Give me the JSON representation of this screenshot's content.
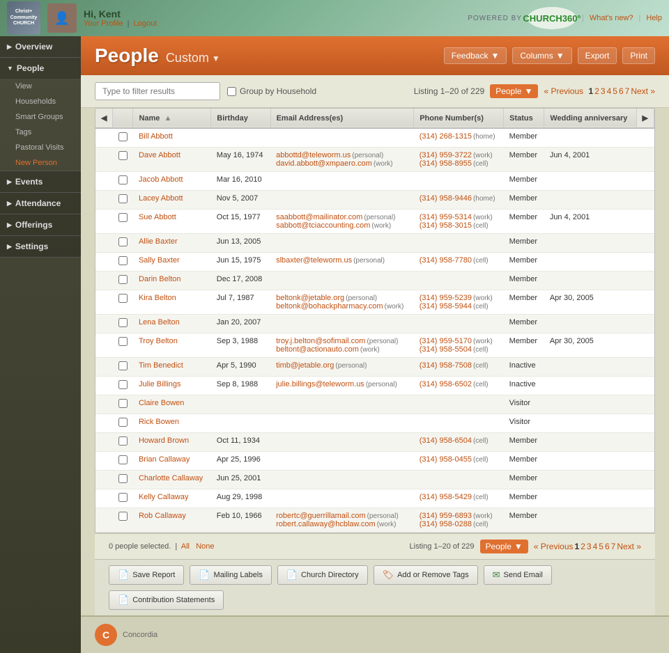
{
  "header": {
    "greeting": "Hi, Kent",
    "profile_link": "Your Profile",
    "logout_link": "Logout",
    "powered_by": "POWERED BY",
    "app_name": "CHURCH360°",
    "whats_new": "What's new?",
    "help": "Help"
  },
  "sidebar": {
    "overview_label": "Overview",
    "people_label": "People",
    "people_sub": {
      "view": "View",
      "households": "Households",
      "smart_groups": "Smart Groups",
      "tags": "Tags",
      "pastoral_visits": "Pastoral Visits",
      "new_person": "New Person"
    },
    "events_label": "Events",
    "attendance_label": "Attendance",
    "offerings_label": "Offerings",
    "settings_label": "Settings"
  },
  "page": {
    "title": "People",
    "subtitle": "Custom",
    "subtitle_arrow": "▼",
    "feedback_btn": "Feedback",
    "columns_btn": "Columns",
    "export_btn": "Export",
    "print_btn": "Print"
  },
  "filter": {
    "placeholder": "Type to filter results",
    "group_by_household": "Group by Household",
    "listing_prefix": "Listing",
    "listing_range": "1–20",
    "listing_of": "of",
    "listing_total": "229",
    "people_btn": "People",
    "prev": "« Previous",
    "pages": [
      "1",
      "2",
      "3",
      "4",
      "5",
      "6",
      "7"
    ],
    "next": "Next »"
  },
  "table": {
    "columns": [
      "Name",
      "Birthday",
      "Email Address(es)",
      "Phone Number(s)",
      "Status",
      "Wedding anniversary"
    ],
    "rows": [
      {
        "name": "Bill Abbott",
        "birthday": "",
        "emails": [],
        "phones": [
          {
            "val": "(314) 268-1315",
            "type": "home"
          }
        ],
        "status": "Member",
        "wedding": ""
      },
      {
        "name": "Dave Abbott",
        "birthday": "May 16, 1974",
        "emails": [
          {
            "val": "abbottd@teleworm.us",
            "type": "personal"
          },
          {
            "val": "david.abbott@xmpaero.com",
            "type": "work"
          }
        ],
        "phones": [
          {
            "val": "(314) 959-3722",
            "type": "work"
          },
          {
            "val": "(314) 958-8955",
            "type": "cell"
          }
        ],
        "status": "Member",
        "wedding": "Jun 4, 2001"
      },
      {
        "name": "Jacob Abbott",
        "birthday": "Mar 16, 2010",
        "emails": [],
        "phones": [],
        "status": "Member",
        "wedding": ""
      },
      {
        "name": "Lacey Abbott",
        "birthday": "Nov 5, 2007",
        "emails": [],
        "phones": [
          {
            "val": "(314) 958-9446",
            "type": "home"
          }
        ],
        "status": "Member",
        "wedding": ""
      },
      {
        "name": "Sue Abbott",
        "birthday": "Oct 15, 1977",
        "emails": [
          {
            "val": "saabbott@mailinator.com",
            "type": "personal"
          },
          {
            "val": "sabbott@tciaccounting.com",
            "type": "work"
          }
        ],
        "phones": [
          {
            "val": "(314) 959-5314",
            "type": "work"
          },
          {
            "val": "(314) 958-3015",
            "type": "cell"
          }
        ],
        "status": "Member",
        "wedding": "Jun 4, 2001"
      },
      {
        "name": "Allie Baxter",
        "birthday": "Jun 13, 2005",
        "emails": [],
        "phones": [],
        "status": "Member",
        "wedding": ""
      },
      {
        "name": "Sally Baxter",
        "birthday": "Jun 15, 1975",
        "emails": [
          {
            "val": "slbaxter@teleworm.us",
            "type": "personal"
          }
        ],
        "phones": [
          {
            "val": "(314) 958-7780",
            "type": "cell"
          }
        ],
        "status": "Member",
        "wedding": ""
      },
      {
        "name": "Darin Belton",
        "birthday": "Dec 17, 2008",
        "emails": [],
        "phones": [],
        "status": "Member",
        "wedding": ""
      },
      {
        "name": "Kira Belton",
        "birthday": "Jul 7, 1987",
        "emails": [
          {
            "val": "beltonk@jetable.org",
            "type": "personal"
          },
          {
            "val": "beltonk@bohackpharmacy.com",
            "type": "work"
          }
        ],
        "phones": [
          {
            "val": "(314) 959-5239",
            "type": "work"
          },
          {
            "val": "(314) 958-5944",
            "type": "cell"
          }
        ],
        "status": "Member",
        "wedding": "Apr 30, 2005"
      },
      {
        "name": "Lena Belton",
        "birthday": "Jan 20, 2007",
        "emails": [],
        "phones": [],
        "status": "Member",
        "wedding": ""
      },
      {
        "name": "Troy Belton",
        "birthday": "Sep 3, 1988",
        "emails": [
          {
            "val": "troy.j.belton@sofimail.com",
            "type": "personal"
          },
          {
            "val": "beltont@actionauto.com",
            "type": "work"
          }
        ],
        "phones": [
          {
            "val": "(314) 959-5170",
            "type": "work"
          },
          {
            "val": "(314) 958-5504",
            "type": "cell"
          }
        ],
        "status": "Member",
        "wedding": "Apr 30, 2005"
      },
      {
        "name": "Tim Benedict",
        "birthday": "Apr 5, 1990",
        "emails": [
          {
            "val": "timb@jetable.org",
            "type": "personal"
          }
        ],
        "phones": [
          {
            "val": "(314) 958-7508",
            "type": "cell"
          }
        ],
        "status": "Inactive",
        "wedding": ""
      },
      {
        "name": "Julie Billings",
        "birthday": "Sep 8, 1988",
        "emails": [
          {
            "val": "julie.billings@teleworm.us",
            "type": "personal"
          }
        ],
        "phones": [
          {
            "val": "(314) 958-6502",
            "type": "cell"
          }
        ],
        "status": "Inactive",
        "wedding": ""
      },
      {
        "name": "Claire Bowen",
        "birthday": "",
        "emails": [],
        "phones": [],
        "status": "Visitor",
        "wedding": ""
      },
      {
        "name": "Rick Bowen",
        "birthday": "",
        "emails": [],
        "phones": [],
        "status": "Visitor",
        "wedding": ""
      },
      {
        "name": "Howard Brown",
        "birthday": "Oct 11, 1934",
        "emails": [],
        "phones": [
          {
            "val": "(314) 958-6504",
            "type": "cell"
          }
        ],
        "status": "Member",
        "wedding": ""
      },
      {
        "name": "Brian Callaway",
        "birthday": "Apr 25, 1996",
        "emails": [],
        "phones": [
          {
            "val": "(314) 958-0455",
            "type": "cell"
          }
        ],
        "status": "Member",
        "wedding": ""
      },
      {
        "name": "Charlotte Callaway",
        "birthday": "Jun 25, 2001",
        "emails": [],
        "phones": [],
        "status": "Member",
        "wedding": ""
      },
      {
        "name": "Kelly Callaway",
        "birthday": "Aug 29, 1998",
        "emails": [],
        "phones": [
          {
            "val": "(314) 958-5429",
            "type": "cell"
          }
        ],
        "status": "Member",
        "wedding": ""
      },
      {
        "name": "Rob Callaway",
        "birthday": "Feb 10, 1966",
        "emails": [
          {
            "val": "robertc@guerrillamail.com",
            "type": "personal"
          },
          {
            "val": "robert.callaway@hcblaw.com",
            "type": "work"
          }
        ],
        "phones": [
          {
            "val": "(314) 959-6893",
            "type": "work"
          },
          {
            "val": "(314) 958-0288",
            "type": "cell"
          }
        ],
        "status": "Member",
        "wedding": ""
      }
    ]
  },
  "bottom": {
    "selected": "0 people selected.",
    "all_link": "All",
    "none_link": "None",
    "listing_prefix": "Listing",
    "listing_range": "1–20",
    "listing_of": "of",
    "listing_total": "229",
    "people_btn": "People",
    "prev": "« Previous",
    "pages": [
      "1",
      "2",
      "3",
      "4",
      "5",
      "6",
      "7"
    ],
    "next": "Next »"
  },
  "actions": {
    "save_report": "Save Report",
    "mailing_labels": "Mailing Labels",
    "church_directory": "Church Directory",
    "add_remove_tags": "Add or Remove Tags",
    "send_email": "Send Email",
    "contribution_statements": "Contribution Statements"
  },
  "footer": {
    "logo_text": "C",
    "name": "Concordia"
  }
}
